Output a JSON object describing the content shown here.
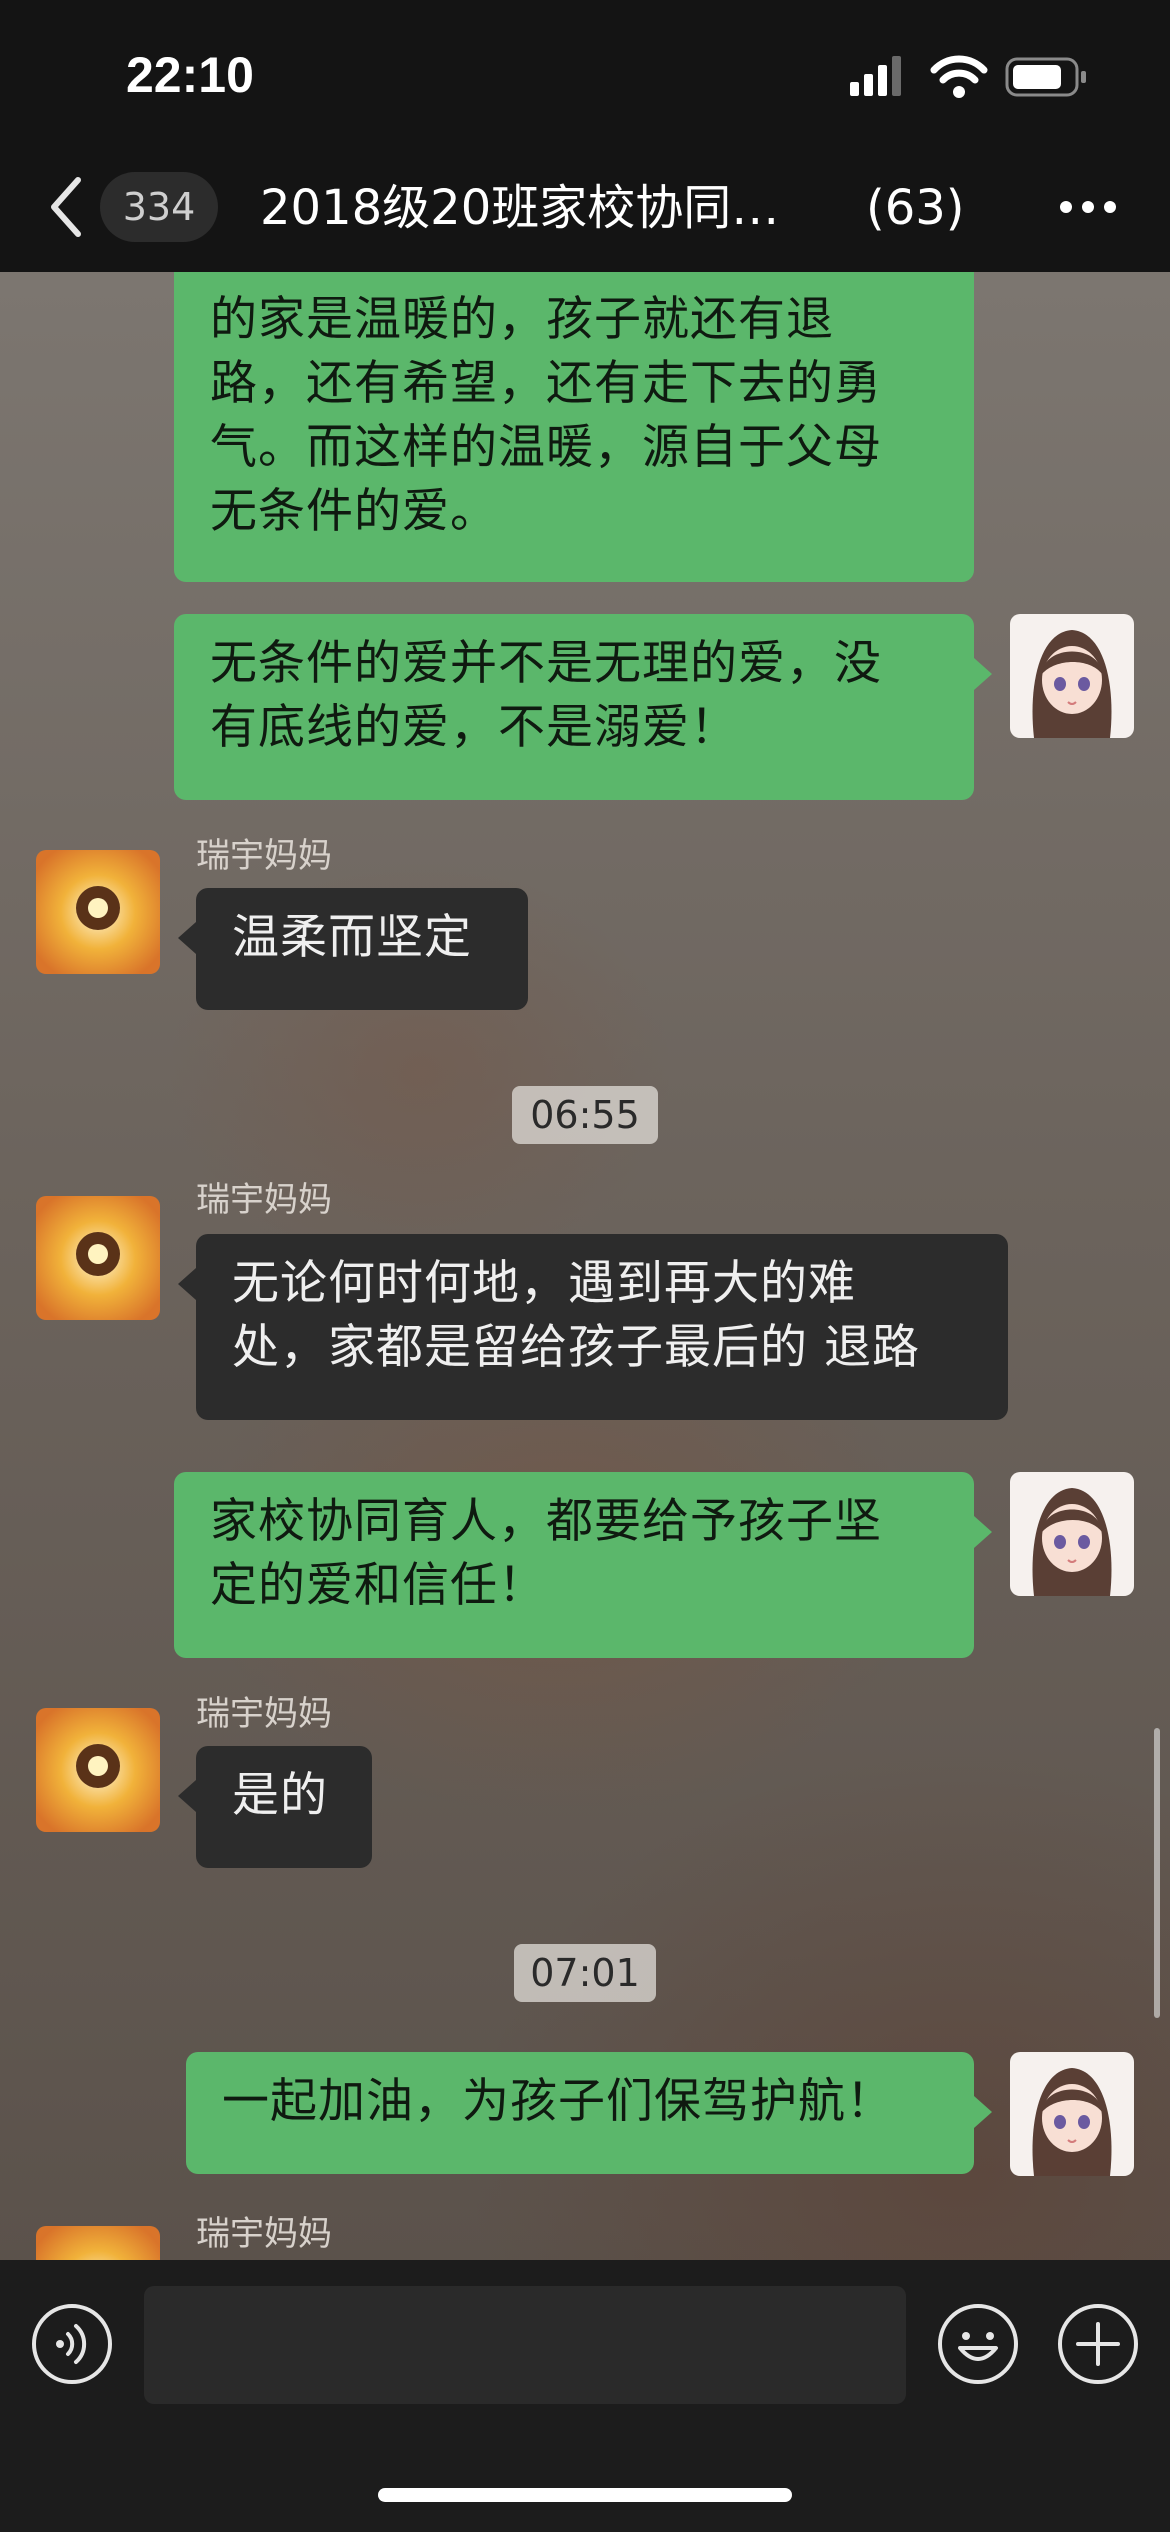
{
  "status_bar": {
    "time": "22:10"
  },
  "nav": {
    "unread_badge": "334",
    "title": "2018级20班家校协同…",
    "member_count": "(63)"
  },
  "messages": [
    {
      "type": "me",
      "lines": [
        "的家是温暖的，孩子就还有退",
        "路，还有希望，还有走下去的勇",
        "气。而这样的温暖，源自于父母",
        "无条件的爱。"
      ]
    },
    {
      "type": "me",
      "lines": [
        "无条件的爱并不是无理的爱，没",
        "有底线的爱，不是溺爱！"
      ]
    },
    {
      "type": "other",
      "sender": "瑞宇妈妈",
      "lines": [
        "温柔而坚定"
      ]
    },
    {
      "type": "time",
      "text": "06:55"
    },
    {
      "type": "other",
      "sender": "瑞宇妈妈",
      "lines": [
        "无论何时何地，遇到再大的难",
        "处，家都是留给孩子最后的 退路"
      ]
    },
    {
      "type": "me",
      "lines": [
        "家校协同育人，都要给予孩子坚",
        "定的爱和信任！"
      ]
    },
    {
      "type": "other",
      "sender": "瑞宇妈妈",
      "lines": [
        "是的"
      ]
    },
    {
      "type": "time",
      "text": "07:01"
    },
    {
      "type": "me",
      "lines": [
        "一起加油，为孩子们保驾护航！"
      ]
    },
    {
      "type": "other",
      "sender": "瑞宇妈妈",
      "lines": []
    }
  ],
  "input_bar": {
    "voice_icon": "voice-icon",
    "emoji_icon": "emoji-icon",
    "add_icon": "plus-icon",
    "text": ""
  },
  "colors": {
    "my_bubble": "#5bb76b",
    "other_bubble": "#2c2c2c",
    "topbar": "#141414"
  }
}
